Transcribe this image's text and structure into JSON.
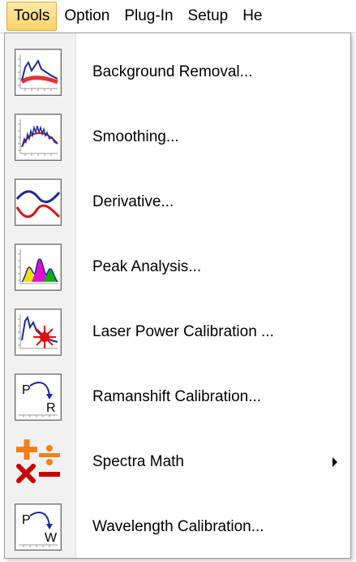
{
  "menubar": {
    "items": [
      "Tools",
      "Option",
      "Plug-In",
      "Setup",
      "He"
    ]
  },
  "dropdown": {
    "items": [
      {
        "label": "Background Removal...",
        "icon": "background-removal-icon"
      },
      {
        "label": "Smoothing...",
        "icon": "smoothing-icon"
      },
      {
        "label": "Derivative...",
        "icon": "derivative-icon"
      },
      {
        "label": "Peak Analysis...",
        "icon": "peak-analysis-icon"
      },
      {
        "label": "Laser Power Calibration ...",
        "icon": "laser-power-calibration-icon"
      },
      {
        "label": "Ramanshift Calibration...",
        "icon": "ramanshift-calibration-icon",
        "icon_letters": [
          "P",
          "R"
        ]
      },
      {
        "label": "Spectra Math",
        "icon": "spectra-math-icon",
        "has_submenu": true
      },
      {
        "label": "Wavelength Calibration...",
        "icon": "wavelength-calibration-icon",
        "icon_letters": [
          "P",
          "W"
        ]
      }
    ]
  },
  "colors": {
    "active_menu_bg": "#f9d36a",
    "active_menu_border": "#e3a93a",
    "gutter": "#f1f1f1",
    "spectrum_blue": "#1a2a9a",
    "spectrum_red": "#e01010"
  }
}
